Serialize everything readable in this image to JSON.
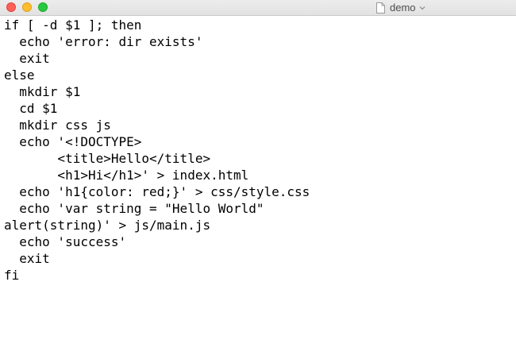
{
  "window": {
    "title": "demo"
  },
  "editor": {
    "lines": [
      "if [ -d $1 ]; then",
      "  echo 'error: dir exists'",
      "  exit",
      "else",
      "  mkdir $1",
      "  cd $1",
      "  mkdir css js",
      "  echo '<!DOCTYPE>",
      "       <title>Hello</title>",
      "       <h1>Hi</h1>' > index.html",
      "  echo 'h1{color: red;}' > css/style.css",
      "  echo 'var string = \"Hello World\"",
      "alert(string)' > js/main.js",
      "  echo 'success'",
      "  exit",
      "fi"
    ]
  },
  "colors": {
    "close": "#ff5f57",
    "minimize": "#ffbd2e",
    "maximize": "#28c940"
  },
  "icons": {
    "document": "document-icon",
    "chevron": "chevron-down-icon"
  }
}
